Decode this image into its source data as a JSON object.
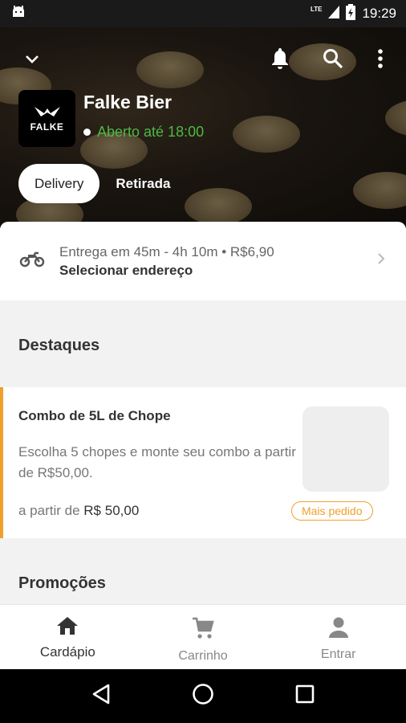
{
  "status_bar": {
    "time": "19:29",
    "network": "LTE"
  },
  "store": {
    "name": "Falke Bier",
    "logo_text": "FALKE",
    "status": "Aberto até 18:00"
  },
  "tabs": {
    "delivery": "Delivery",
    "pickup": "Retirada"
  },
  "delivery": {
    "info": "Entrega em 45m - 4h 10m • R$6,90",
    "address": "Selecionar endereço"
  },
  "sections": {
    "highlights": "Destaques",
    "promotions": "Promoções"
  },
  "product": {
    "name": "Combo de 5L de Chope",
    "description": "Escolha 5 chopes e monte seu combo a partir de R$50,00.",
    "price_prefix": "a partir de",
    "price": "R$ 50,00",
    "badge": "Mais pedido"
  },
  "bottom_nav": {
    "menu": "Cardápio",
    "cart": "Carrinho",
    "login": "Entrar"
  },
  "colors": {
    "accent": "#f0a02a",
    "open_green": "#4cb944"
  },
  "icons": [
    "android-icon",
    "lte-icon",
    "signal-icon",
    "battery-icon",
    "chevron-down-icon",
    "bell-icon",
    "search-icon",
    "more-vert-icon",
    "motorcycle-icon",
    "chevron-right-icon",
    "home-icon",
    "cart-icon",
    "person-icon",
    "back-icon",
    "home-circle-icon",
    "recents-icon"
  ]
}
